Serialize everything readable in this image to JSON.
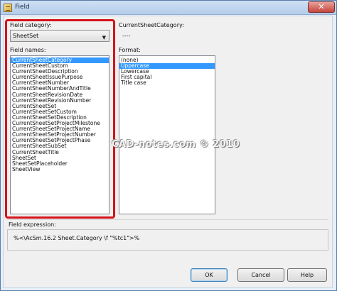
{
  "window": {
    "title": "Field",
    "close_glyph": "✕"
  },
  "field_category": {
    "label": "Field category:",
    "selected": "SheetSet",
    "arrow": "▼"
  },
  "field_names": {
    "label": "Field names:",
    "items": [
      {
        "label": "CurrentSheetCategory",
        "selected": true
      },
      {
        "label": "CurrentSheetCustom",
        "selected": false
      },
      {
        "label": "CurrentSheetDescription",
        "selected": false
      },
      {
        "label": "CurrentSheetIssuePurpose",
        "selected": false
      },
      {
        "label": "CurrentSheetNumber",
        "selected": false
      },
      {
        "label": "CurrentSheetNumberAndTitle",
        "selected": false
      },
      {
        "label": "CurrentSheetRevisionDate",
        "selected": false
      },
      {
        "label": "CurrentSheetRevisionNumber",
        "selected": false
      },
      {
        "label": "CurrentSheetSet",
        "selected": false
      },
      {
        "label": "CurrentSheetSetCustom",
        "selected": false
      },
      {
        "label": "CurrentSheetSetDescription",
        "selected": false
      },
      {
        "label": "CurrentSheetSetProjectMilestone",
        "selected": false
      },
      {
        "label": "CurrentSheetSetProjectName",
        "selected": false
      },
      {
        "label": "CurrentSheetSetProjectNumber",
        "selected": false
      },
      {
        "label": "CurrentSheetSetProjectPhase",
        "selected": false
      },
      {
        "label": "CurrentSheetSubSet",
        "selected": false
      },
      {
        "label": "CurrentSheetTitle",
        "selected": false
      },
      {
        "label": "SheetSet",
        "selected": false
      },
      {
        "label": "SheetSetPlaceholder",
        "selected": false
      },
      {
        "label": "SheetView",
        "selected": false
      }
    ]
  },
  "current_sheet_category": {
    "label": "CurrentSheetCategory:",
    "value": "----"
  },
  "format": {
    "label": "Format:",
    "items": [
      {
        "label": "(none)",
        "selected": false
      },
      {
        "label": "Uppercase",
        "selected": true
      },
      {
        "label": "Lowercase",
        "selected": false
      },
      {
        "label": "First capital",
        "selected": false
      },
      {
        "label": "Title case",
        "selected": false
      }
    ]
  },
  "watermark": "CAD-notes.com © 2010",
  "field_expression": {
    "label": "Field expression:",
    "value": "%<\\AcSm.16.2 Sheet.Category \\f \"%tc1\">%"
  },
  "buttons": {
    "ok": "OK",
    "cancel": "Cancel",
    "help": "Help"
  },
  "colors": {
    "highlight_border": "#d4141a",
    "selection": "#3399ff"
  }
}
